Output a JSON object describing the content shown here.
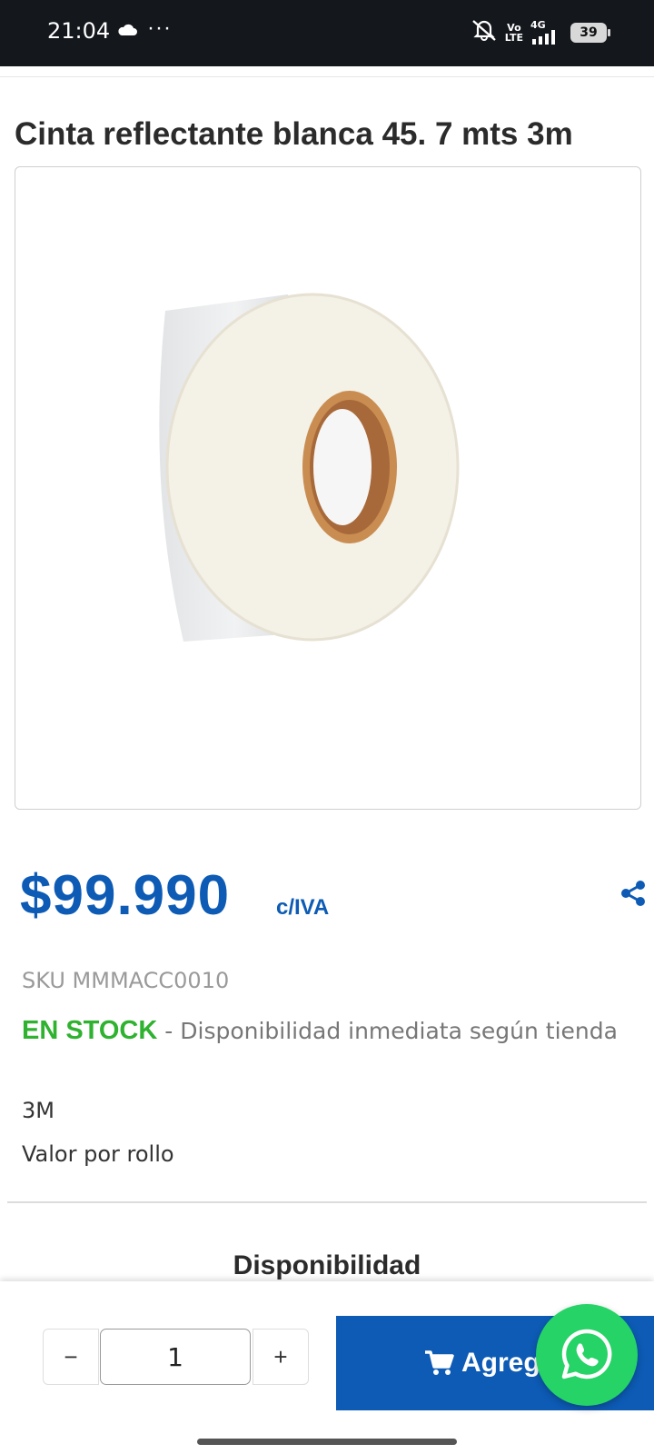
{
  "status_bar": {
    "time": "21:04",
    "dots": "···",
    "network_top": "Vo",
    "network_bottom": "LTE",
    "signal_label": "4G",
    "battery": "39"
  },
  "product": {
    "title": "Cinta reflectante blanca 45. 7 mts 3m",
    "image_icon": "reflective-tape-roll",
    "price": "$99.990",
    "tax_label": "c/IVA",
    "sku": "SKU MMMACC0010",
    "stock_status": "EN STOCK",
    "stock_separator": " - ",
    "stock_detail": "Disponibilidad inmediata según tienda",
    "brand": "3M",
    "unit_note": "Valor por rollo"
  },
  "availability": {
    "title": "Disponibilidad"
  },
  "cart_bar": {
    "minus_label": "−",
    "plus_label": "+",
    "quantity": "1",
    "add_button_label": "Agreg"
  },
  "colors": {
    "brand_blue": "#0d5bb5",
    "in_stock_green": "#2fb22f",
    "whatsapp_green": "#25d366"
  }
}
